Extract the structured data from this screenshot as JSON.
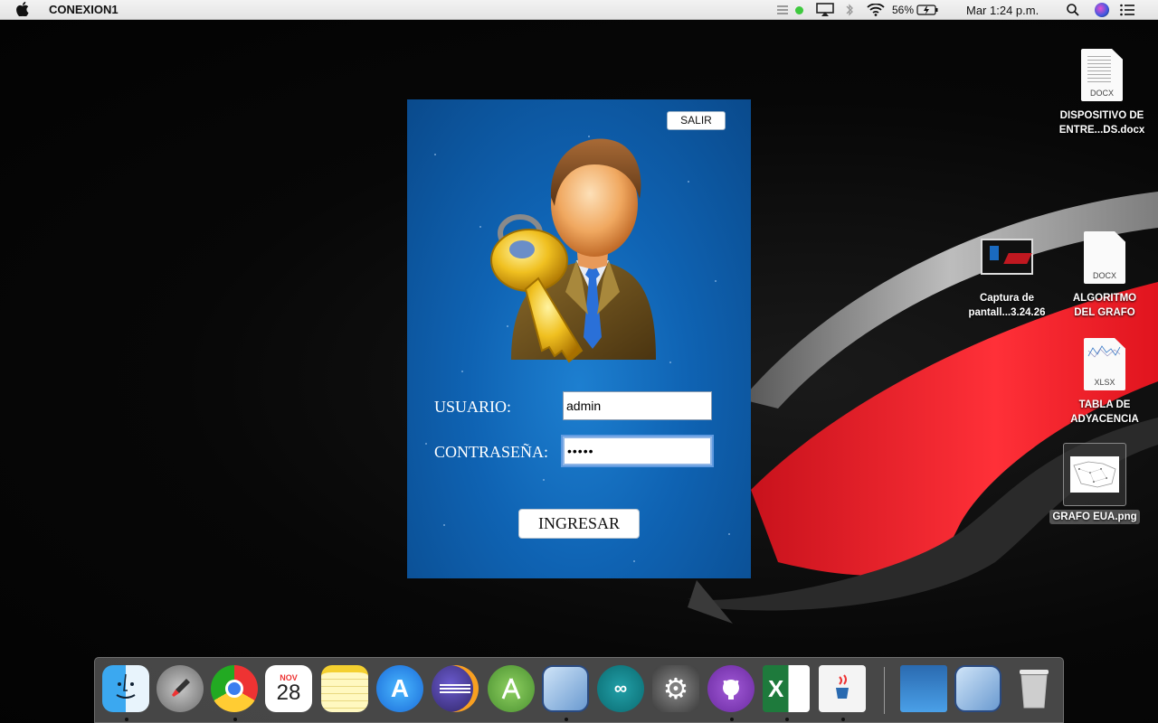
{
  "menubar": {
    "apple_icon": "apple-icon",
    "app_name": "CONEXION1",
    "battery": "56%",
    "clock": "Mar 1:24 p.m."
  },
  "login": {
    "exit_label": "SALIR",
    "user_label": "USUARIO:",
    "user_value": "admin",
    "password_label": "CONTRASEÑA:",
    "password_value": "•••••",
    "submit_label": "INGRESAR"
  },
  "desktop_icons": [
    {
      "name": "DISPOSITIVO DE\nENTRE...DS.docx",
      "ext": "DOCX"
    },
    {
      "name": "Captura de\npantall...3.24.26",
      "ext": ""
    },
    {
      "name": "ALGORITMO\nDEL GRAFO",
      "ext": "DOCX"
    },
    {
      "name": "TABLA DE\nADYACENCIA",
      "ext": "XLSX"
    },
    {
      "name": "GRAFO EUA.png",
      "ext": ""
    }
  ],
  "dock": {
    "calendar_month": "NOV",
    "calendar_day": "28",
    "excel_letter": "X"
  }
}
